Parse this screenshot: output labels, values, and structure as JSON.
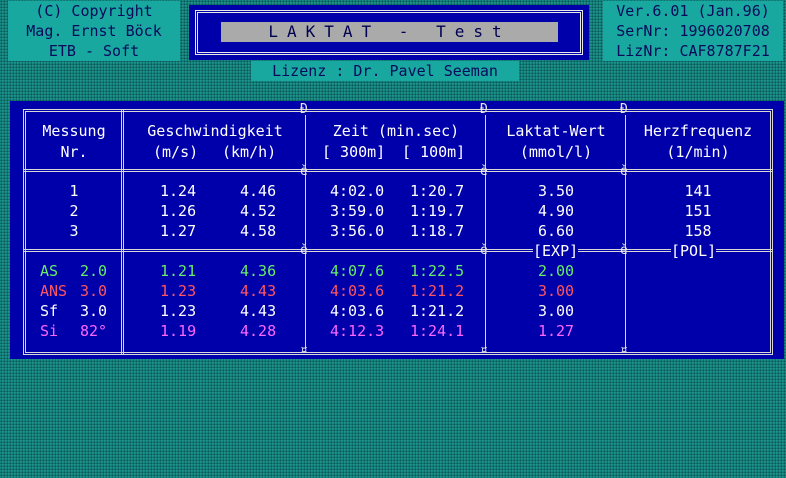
{
  "header": {
    "copyright_lines": [
      "(C) Copyright",
      "Mag. Ernst Böck",
      "ETB - Soft"
    ],
    "title": "LAKTAT - Test",
    "version_lines": [
      "Ver.6.01 (Jan.96)",
      "SerNr: 1996020708",
      "LizNr: CAF8787F21"
    ],
    "license": "Lizenz : Dr. Pavel Seeman"
  },
  "table": {
    "headers": {
      "messung": [
        "Messung",
        "Nr."
      ],
      "geschwindigkeit": "Geschwindigkeit",
      "geschw_units": [
        "(m/s)",
        "(km/h)"
      ],
      "zeit": "Zeit (min.sec)",
      "zeit_units": [
        "[ 300m]",
        "[ 100m]"
      ],
      "laktat": [
        "Laktat-Wert",
        "(mmol/l)"
      ],
      "herz": [
        "Herzfrequenz",
        "(1/min)"
      ]
    },
    "rows": [
      {
        "nr": "1",
        "ms": "1.24",
        "kmh": "4.46",
        "t300": "4:02.0",
        "t100": "1:20.7",
        "laktat": "3.50",
        "hf": "141"
      },
      {
        "nr": "2",
        "ms": "1.26",
        "kmh": "4.52",
        "t300": "3:59.0",
        "t100": "1:19.7",
        "laktat": "4.90",
        "hf": "151"
      },
      {
        "nr": "3",
        "ms": "1.27",
        "kmh": "4.58",
        "t300": "3:56.0",
        "t100": "1:18.7",
        "laktat": "6.60",
        "hf": "158"
      }
    ],
    "tags": {
      "exp": "[EXP]",
      "pol": "[POL]"
    },
    "results": [
      {
        "label": "AS",
        "value": "2.0",
        "ms": "1.21",
        "kmh": "4.36",
        "t300": "4:07.6",
        "t100": "1:22.5",
        "laktat": "2.00",
        "color": "#66ee66"
      },
      {
        "label": "ANS",
        "value": "3.0",
        "ms": "1.23",
        "kmh": "4.43",
        "t300": "4:03.6",
        "t100": "1:21.2",
        "laktat": "3.00",
        "color": "#ff5560"
      },
      {
        "label": "Sf",
        "value": "3.0",
        "ms": "1.23",
        "kmh": "4.43",
        "t300": "4:03.6",
        "t100": "1:21.2",
        "laktat": "3.00",
        "color": "#ffffff"
      },
      {
        "label": "Si",
        "value": "82°",
        "ms": "1.19",
        "kmh": "4.28",
        "t300": "4:12.3",
        "t100": "1:24.1",
        "laktat": "1.27",
        "color": "#ff66ff"
      }
    ]
  },
  "colors": {
    "screen_bg": "#0e8a84",
    "panel_bg": "#0000aa",
    "info_box": "#18a8a0",
    "title_bar": "#aaaaaa"
  }
}
